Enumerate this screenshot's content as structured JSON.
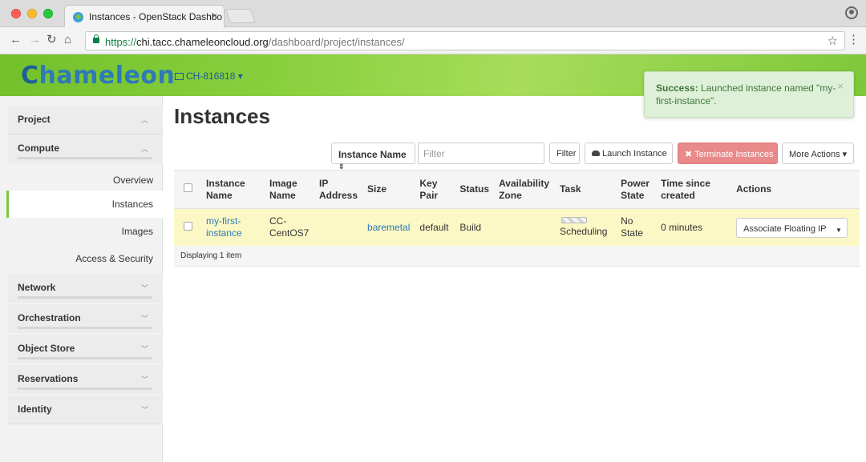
{
  "browser": {
    "tab_title": "Instances - OpenStack Dashbo",
    "tab_close": "×",
    "url": {
      "scheme": "https://",
      "host": "chi.tacc.chameleoncloud.org",
      "path": "/dashboard/project/instances/"
    },
    "colors": {
      "close": "#fc5f57",
      "minimize": "#fdbc2e",
      "maximize": "#27c840"
    }
  },
  "header": {
    "logo_first": "C",
    "logo_rest": "hameleon",
    "project_picker": "CH-816818"
  },
  "sidebar": {
    "sections": [
      {
        "label": "Project",
        "expanded": true
      },
      {
        "label": "Compute",
        "expanded": true
      },
      {
        "label": "Network",
        "expanded": false
      },
      {
        "label": "Orchestration",
        "expanded": false
      },
      {
        "label": "Object Store",
        "expanded": false
      },
      {
        "label": "Reservations",
        "expanded": false
      },
      {
        "label": "Identity",
        "expanded": false
      }
    ],
    "compute_items": [
      {
        "label": "Overview",
        "active": false
      },
      {
        "label": "Instances",
        "active": true
      },
      {
        "label": "Images",
        "active": false
      },
      {
        "label": "Access & Security",
        "active": false
      }
    ]
  },
  "main": {
    "title": "Instances",
    "filter": {
      "select_value": "Instance Name",
      "input_placeholder": "Filter",
      "filter_button": "Filter"
    },
    "actions": {
      "launch": "Launch Instance",
      "terminate": "Terminate Instances",
      "more": "More Actions"
    },
    "alert": {
      "strong": "Success:",
      "message": "Launched instance named \"my-first-instance\".",
      "close": "×"
    },
    "table": {
      "headers": [
        "Instance Name",
        "Image Name",
        "IP Address",
        "Size",
        "Key Pair",
        "Status",
        "Availability Zone",
        "Task",
        "Power State",
        "Time since created",
        "Actions"
      ],
      "rows": [
        {
          "instance_name": "my-first-instance",
          "image_name": "CC-CentOS7",
          "ip_address": "",
          "size": "baremetal",
          "key_pair": "default",
          "status": "Build",
          "availability_zone": "",
          "task": "Scheduling",
          "power_state": "No State",
          "time_since_created": "0 minutes",
          "action": "Associate Floating IP"
        }
      ],
      "footer": "Displaying 1 item"
    }
  }
}
